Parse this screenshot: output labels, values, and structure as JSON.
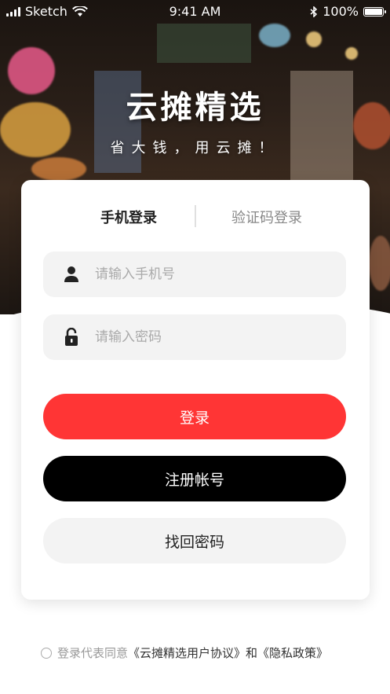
{
  "status_bar": {
    "carrier": "Sketch",
    "time": "9:41 AM",
    "battery": "100%",
    "battery_level": 1.0
  },
  "hero": {
    "title": "云摊精选",
    "subtitle": "省大钱，用云摊！"
  },
  "login": {
    "tabs": [
      {
        "label": "手机登录",
        "active": true
      },
      {
        "label": "验证码登录",
        "active": false
      }
    ],
    "phone_field": {
      "placeholder": "请输入手机号",
      "icon": "user-icon"
    },
    "password_field": {
      "placeholder": "请输入密码",
      "icon": "lock-icon"
    },
    "login_button": "登录",
    "register_button": "注册帐号",
    "recover_button": "找回密码"
  },
  "agreement": {
    "prefix": "登录代表同意",
    "user_agreement": "《云摊精选用户协议》",
    "and": "和",
    "privacy_policy": "《隐私政策》"
  },
  "colors": {
    "accent_red": "#ff3535",
    "black": "#000000",
    "field_bg": "#f3f3f3"
  }
}
